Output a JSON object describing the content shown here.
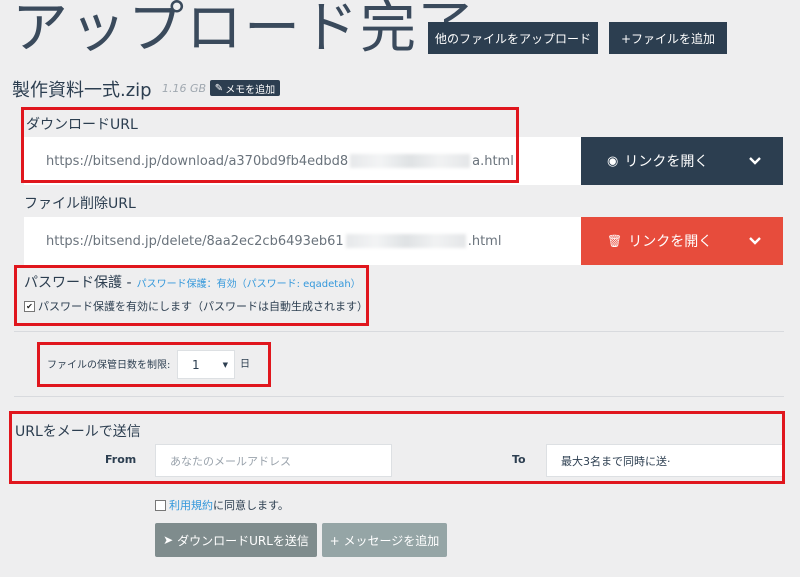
{
  "header": {
    "title": "アップロード完了",
    "other_upload_label": "他のファイルをアップロード",
    "add_file_label": "+ファイルを追加"
  },
  "file": {
    "name": "製作資料一式.zip",
    "size": "1.16 GB",
    "memo_label": "メモを追加"
  },
  "download": {
    "label": "ダウンロードURL",
    "url_prefix": "https://bitsend.jp/download/a370bd9fb4edbd8",
    "url_suffix": "a.html",
    "open_label": "リンクを開く",
    "color": "#2c3e50"
  },
  "delete": {
    "label": "ファイル削除URL",
    "url_prefix": "https://bitsend.jp/delete/8aa2ec2cb6493eb61",
    "url_suffix": ".html",
    "open_label": "リンクを開く",
    "color": "#e74c3c"
  },
  "password": {
    "title": "パスワード保護 -",
    "status": "パスワード保護：有効（パスワード: eqadetah）",
    "checkbox_label": "パスワード保護を有効にします（パスワードは自動生成されます）",
    "checked": true
  },
  "retention": {
    "label": "ファイルの保管日数を制限:",
    "value": "1",
    "unit": "日"
  },
  "email": {
    "section_title": "URLをメールで送信",
    "from_label": "From",
    "from_placeholder": "あなたのメールアドレス",
    "to_label": "To",
    "to_placeholder": "最大3名まで同時に送·"
  },
  "terms": {
    "link": "利用規約",
    "text": "に同意します。"
  },
  "actions": {
    "send_label": "ダウンロードURLを送信",
    "message_label": "+ メッセージを追加"
  },
  "colors": {
    "dark": "#2c3e50",
    "danger": "#e74c3c",
    "highlight": "#e0161d",
    "link": "#3498db",
    "muted": "#7f8c8d"
  }
}
